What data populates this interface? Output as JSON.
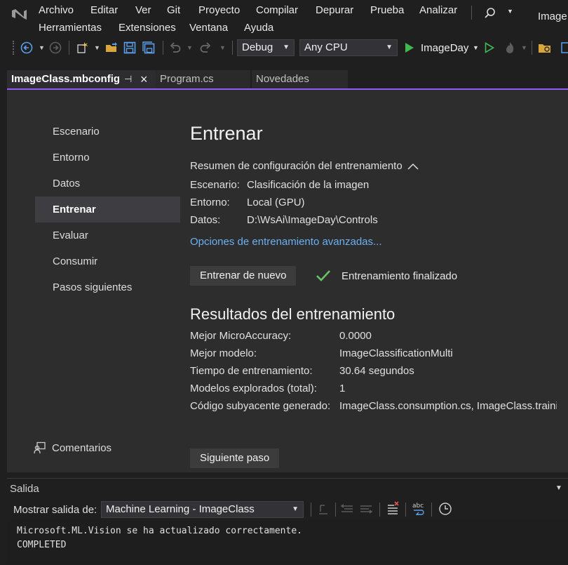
{
  "colors": {
    "accent_purple": "#8e5cf7",
    "play_green": "#3fb950",
    "link_blue": "#6ab0f3",
    "check_green": "#69c36b",
    "active_nav_bg": "#3e3e42"
  },
  "menubar": {
    "items": [
      "Archivo",
      "Editar",
      "Ver",
      "Git",
      "Proyecto",
      "Compilar",
      "Depurar",
      "Prueba",
      "Analizar"
    ],
    "items_row2": [
      "Herramientas",
      "Extensiones",
      "Ventana",
      "Ayuda"
    ],
    "title_partial": "Image"
  },
  "toolbar": {
    "config_value": "Debug",
    "platform_value": "Any CPU",
    "run_target": "ImageDay"
  },
  "tabs": [
    {
      "label": "ImageClass.mbconfig",
      "active": true
    },
    {
      "label": "Program.cs",
      "active": false
    },
    {
      "label": "Novedades",
      "active": false
    }
  ],
  "nav": {
    "items": [
      "Escenario",
      "Entorno",
      "Datos",
      "Entrenar",
      "Evaluar",
      "Consumir",
      "Pasos siguientes"
    ],
    "active_index": 3,
    "feedback_label": "Comentarios"
  },
  "main": {
    "title": "Entrenar",
    "summary_header": "Resumen de configuración del entrenamiento",
    "summary": [
      {
        "label": "Escenario:",
        "value": "Clasificación de la imagen"
      },
      {
        "label": "Entorno:",
        "value": "Local (GPU)"
      },
      {
        "label": "Datos:",
        "value": "D:\\WsAi\\ImageDay\\Controls"
      }
    ],
    "advanced_link": "Opciones de entrenamiento avanzadas...",
    "retrain_button": "Entrenar de nuevo",
    "status_text": "Entrenamiento finalizado",
    "results_title": "Resultados del entrenamiento",
    "results": [
      {
        "label": "Mejor MicroAccuracy:",
        "value": "0.0000"
      },
      {
        "label": "Mejor modelo:",
        "value": "ImageClassificationMulti"
      },
      {
        "label": "Tiempo de entrenamiento:",
        "value": "30.64 segundos"
      },
      {
        "label": "Modelos explorados (total):",
        "value": "1"
      },
      {
        "label": "Código subyacente generado:",
        "value": "ImageClass.consumption.cs, ImageClass.training.cs"
      }
    ],
    "next_button": "Siguiente paso"
  },
  "output": {
    "title": "Salida",
    "show_output_label": "Mostrar salida de:",
    "source_value": "Machine Learning - ImageClass",
    "lines": [
      "Microsoft.ML.Vision se ha actualizado correctamente.",
      "COMPLETED"
    ]
  }
}
